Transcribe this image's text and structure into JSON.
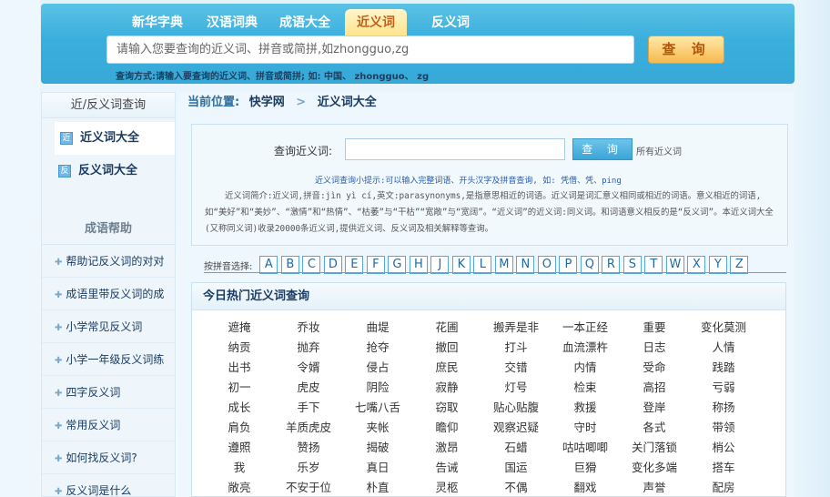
{
  "nav": {
    "tabs": [
      "新华字典",
      "汉语词典",
      "成语大全",
      "近义词",
      "反义词"
    ],
    "active_index": 3
  },
  "search": {
    "placeholder": "请输入您要查询的近义词、拼音或简拼,如zhongguo,zg",
    "button_label": "查 询",
    "tip": "查询方式:请输入要查询的近义词、拼音或简拼; 如: 中国、 zhongguo、 zg"
  },
  "sidebar": {
    "title": "近/反义词查询",
    "items": [
      {
        "label": "近义词大全",
        "icon": "近"
      },
      {
        "label": "反义词大全",
        "icon": "反"
      }
    ],
    "help_title": "成语帮助",
    "help_items": [
      "帮助记反义词的对对",
      "成语里带反义词的成",
      "小学常见反义词",
      "小学一年级反义词练",
      "四字反义词",
      "常用反义词",
      "如何找反义词?",
      "反义词是什么"
    ]
  },
  "breadcrumb": {
    "prefix": "当前位置:",
    "home": "快学网",
    "current": "近义词大全"
  },
  "query": {
    "label": "查询近义词:",
    "button_label": "查 询",
    "all_link": "所有近义词",
    "hint": "近义词查询小提示:可以输入完整词语、开头汉字及拼音查询, 如: 凭借、凭、ping",
    "intro": "近义词简介:近义词,拼音:jìn yì cí,英文:parasynonyms,是指意思相近的词语。近义词是词汇意义相同或相近的词语。意义相近的词语,如“美好”和“美妙”、“激情”和“热情”、“枯萎”与“干枯”“宽敞”与“宽阔”。“近义词”的近义词:同义词。和词语意义相反的是“反义词”。本近义词大全(又称同义词)收录20000条近义词,提供近义词、反义词及相关解释等查询。"
  },
  "pinyin": {
    "label": "按拼音选择:",
    "letters": [
      "A",
      "B",
      "C",
      "D",
      "E",
      "F",
      "G",
      "H",
      "J",
      "K",
      "L",
      "M",
      "N",
      "O",
      "P",
      "Q",
      "R",
      "S",
      "T",
      "W",
      "X",
      "Y",
      "Z"
    ]
  },
  "hot": {
    "title": "今日热门近义词查询",
    "words": [
      "遮掩",
      "乔妆",
      "曲堤",
      "花圃",
      "搬弄是非",
      "一本正经",
      "重要",
      "变化莫测",
      "纳贡",
      "抛弃",
      "抢夺",
      "撤回",
      "打斗",
      "血流漂杵",
      "日志",
      "人情",
      "出书",
      "令婿",
      "侵占",
      "庶民",
      "交错",
      "内情",
      "受命",
      "践踏",
      "初一",
      "虎皮",
      "阴险",
      "寂静",
      "灯号",
      "检束",
      "高招",
      "亏弱",
      "成长",
      "手下",
      "七嘴八舌",
      "窃取",
      "贴心贴腹",
      "救援",
      "登岸",
      "称扬",
      "肩负",
      "羊质虎皮",
      "夹帐",
      "瞻仰",
      "观察迟疑",
      "守时",
      "各式",
      "带领",
      "遵照",
      "赞扬",
      "揭破",
      "激昂",
      "石蜡",
      "咕咕唧唧",
      "关门落锁",
      "梢公",
      "我",
      "乐岁",
      "真日",
      "告诫",
      "国运",
      "巨猾",
      "变化多端",
      "搭车",
      "敞亮",
      "不安于位",
      "朴直",
      "灵柩",
      "不偶",
      "翻戏",
      "声誉",
      "配房"
    ]
  }
}
